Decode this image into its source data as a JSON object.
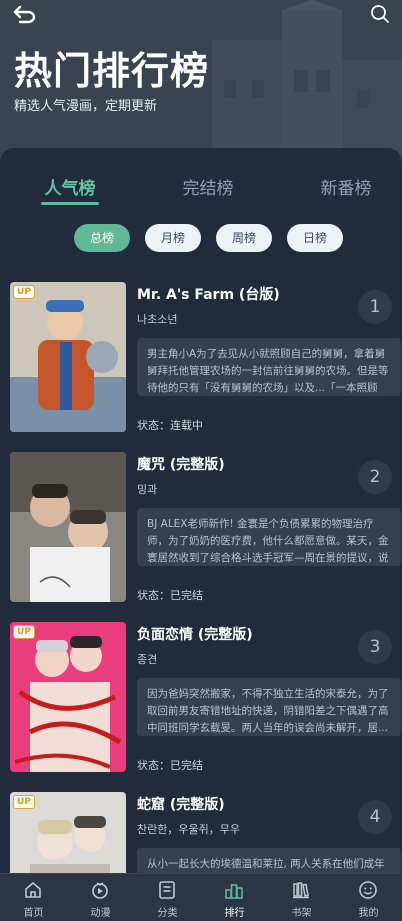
{
  "header": {
    "title": "热门排行榜",
    "subtitle": "精选人气漫画，定期更新"
  },
  "tabs": [
    {
      "label": "人气榜",
      "active": true
    },
    {
      "label": "完结榜",
      "active": false
    },
    {
      "label": "新番榜",
      "active": false
    }
  ],
  "chips": [
    {
      "label": "总榜",
      "active": true
    },
    {
      "label": "月榜",
      "active": false
    },
    {
      "label": "周榜",
      "active": false
    },
    {
      "label": "日榜",
      "active": false
    }
  ],
  "items": [
    {
      "badge": "UP",
      "title": "Mr. A's Farm (台版)",
      "author": "나초소년",
      "rank": "1",
      "desc": "男主角小A为了去见从小就照顾自己的舅舅，拿着舅舅拜托他管理农场的一封信前往舅舅的农场。但是等待他的只有「没有舅舅的农场」以及...「一本照顾家...",
      "status": "状态：连载中",
      "cover_colors": [
        "#c9c3b6",
        "#8c5a3c"
      ]
    },
    {
      "badge": "",
      "title": "魔咒 (完整版)",
      "author": "밍과",
      "rank": "2",
      "desc": "BJ ALEX老师新作! 金寰是个负债累累的物理治疗师，为了奶奶的医疗费，他什么都愿意做。某天，金寰居然收到了综合格斗选手冠军—周在景的提议，说要...",
      "status": "状态：已完结",
      "cover_colors": [
        "#7a7772",
        "#2b2725"
      ]
    },
    {
      "badge": "UP",
      "title": "负面恋情 (完整版)",
      "author": "종견",
      "rank": "3",
      "desc": "因为爸妈突然搬家，不得不独立生活的宋泰允，为了取回前男友寄错地址的快递，阴错阳差之下偶遇了高中同班同学玄载旻。两人当年的误会尚未解开，居...",
      "status": "状态：已完结",
      "cover_colors": [
        "#e8407a",
        "#c8241f"
      ]
    },
    {
      "badge": "UP",
      "title": "蛇窟 (完整版)",
      "author": "찬란한，우울쥐，무우",
      "rank": "4",
      "desc": "从小一起长大的埃德温和莱拉, 两人关系在他们成年的...",
      "status": "",
      "cover_colors": [
        "#d8d6d2",
        "#9a9690"
      ]
    }
  ],
  "nav": [
    {
      "label": "首页",
      "icon": "home-icon",
      "active": false
    },
    {
      "label": "动漫",
      "icon": "video-icon",
      "active": false
    },
    {
      "label": "分类",
      "icon": "category-icon",
      "active": false
    },
    {
      "label": "排行",
      "icon": "ranking-icon",
      "active": true
    },
    {
      "label": "书架",
      "icon": "bookshelf-icon",
      "active": false
    },
    {
      "label": "我的",
      "icon": "profile-icon",
      "active": false
    }
  ],
  "colors": {
    "accent": "#5fb896",
    "background": "#222b3c",
    "header": "#3a4352"
  }
}
